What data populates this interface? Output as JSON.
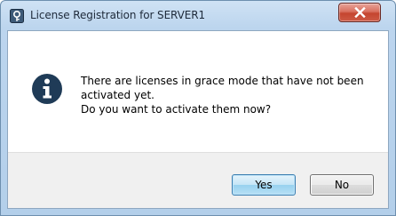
{
  "window": {
    "title": "License Registration for SERVER1",
    "app_icon": "license-server-icon",
    "close_icon": "close-icon"
  },
  "dialog": {
    "icon": "info-icon",
    "message_lines": [
      "There are licenses in grace mode that have not been activated yet.",
      "Do you want to activate them now?"
    ]
  },
  "buttons": {
    "yes_label": "Yes",
    "no_label": "No"
  },
  "colors": {
    "info_icon": "#1f3b57",
    "close_button": "#c4452f",
    "default_button_border": "#3c7fb1",
    "title_frame": "#bcd5ee"
  }
}
